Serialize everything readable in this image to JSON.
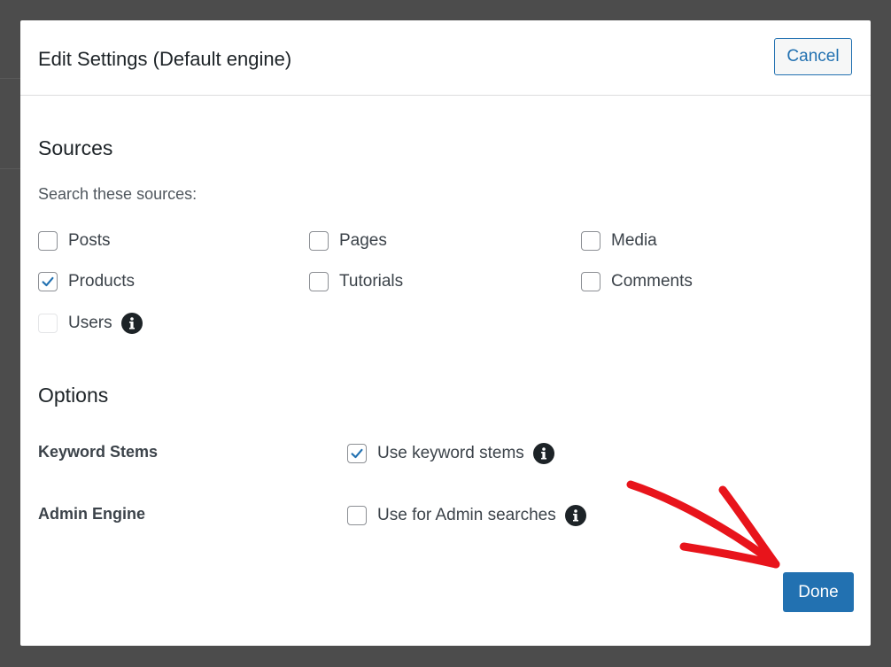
{
  "modal": {
    "title": "Edit Settings (Default engine)",
    "cancel_label": "Cancel",
    "done_label": "Done"
  },
  "sources": {
    "heading": "Sources",
    "description": "Search these sources:",
    "items": [
      {
        "label": "Posts",
        "checked": false
      },
      {
        "label": "Pages",
        "checked": false
      },
      {
        "label": "Media",
        "checked": false
      },
      {
        "label": "Products",
        "checked": true
      },
      {
        "label": "Tutorials",
        "checked": false
      },
      {
        "label": "Comments",
        "checked": false
      },
      {
        "label": "Users",
        "checked": false,
        "disabled": true
      }
    ]
  },
  "options": {
    "heading": "Options",
    "rows": [
      {
        "label": "Keyword Stems",
        "option": "Use keyword stems",
        "checked": true
      },
      {
        "label": "Admin Engine",
        "option": "Use for Admin searches",
        "checked": false
      }
    ]
  },
  "colors": {
    "accent": "#2271b1",
    "annotation_arrow": "#e8141b"
  }
}
